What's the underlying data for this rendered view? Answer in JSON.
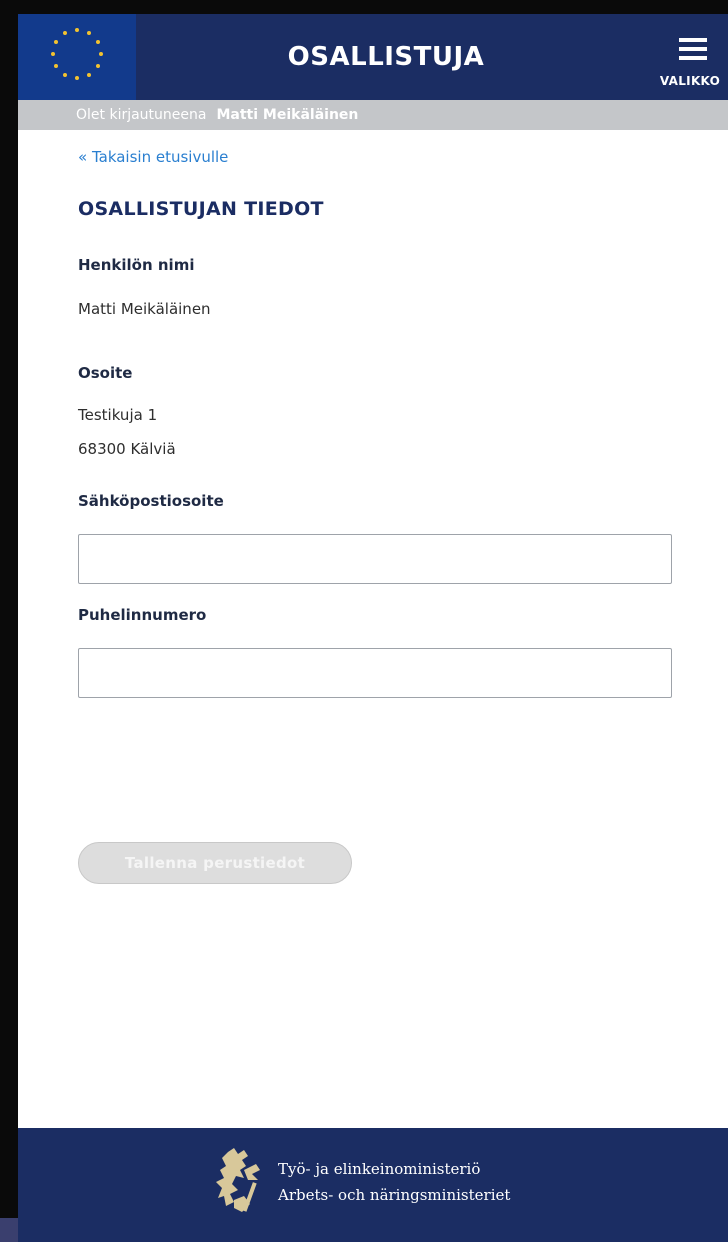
{
  "header": {
    "title": "OSALLISTUJA",
    "menu_label": "VALIKKO",
    "flag_icon": "eu-flag-icon",
    "menu_icon": "hamburger-icon"
  },
  "login_bar": {
    "prefix": "Olet kirjautuneena",
    "user_name": "Matti Meikäläinen"
  },
  "main": {
    "back_link": "« Takaisin etusivulle",
    "page_title": "OSALLISTUJAN TIEDOT",
    "name_label": "Henkilön nimi",
    "name_value": "Matti Meikäläinen",
    "address_label": "Osoite",
    "address_line1": "Testikuja 1",
    "address_line2": "68300 Kälviä",
    "email_label": "Sähköpostiosoite",
    "email_value": "",
    "phone_label": "Puhelinnumero",
    "phone_value": "",
    "save_button": "Tallenna perustiedot"
  },
  "footer": {
    "line1": "Työ- ja elinkeinoministeriö",
    "line2": "Arbets- och näringsministeriet",
    "logo_icon": "lion-coat-of-arms-icon"
  },
  "colors": {
    "header_bg": "#1b2d63",
    "flag_bg": "#123a8c",
    "login_bar_bg": "#c4c6c9",
    "link": "#2a7fd0",
    "button_disabled": "#dddddd"
  }
}
